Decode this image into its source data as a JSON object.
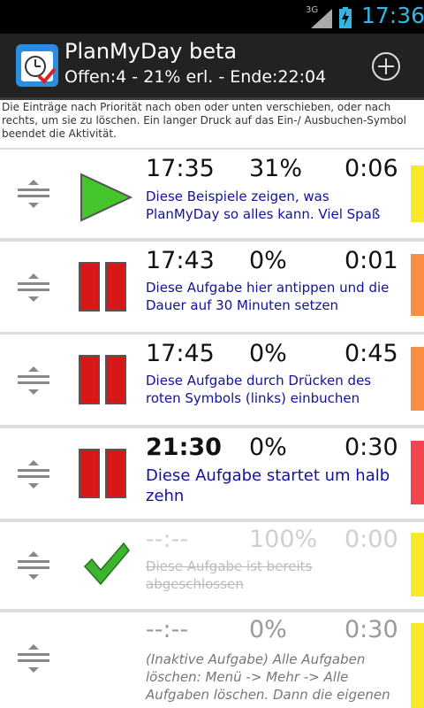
{
  "statusbar": {
    "network": "3G",
    "time": "17:36"
  },
  "header": {
    "title": "PlanMyDay beta",
    "subtitle": "Offen:4 - 21% erl. - Ende:22:04"
  },
  "help_text": "Die Einträge nach Priorität nach oben oder unten verschieben, oder nach rechts, um sie zu löschen. Ein langer Druck auf das Ein-/ Ausbuchen-Symbol beendet die Aktivität.",
  "colors": {
    "yellow": "#f7e92a",
    "orange": "#f78e41",
    "red": "#f0474f"
  },
  "tasks": [
    {
      "time": "17:35",
      "percent": "31%",
      "duration": "0:06",
      "description": "Diese Beispiele zeigen, was PlanMyDay so alles kann. Viel Spaß",
      "status": "play-icon",
      "priority_color": "yellow"
    },
    {
      "time": "17:43",
      "percent": "0%",
      "duration": "0:01",
      "description": "Diese Aufgabe hier antippen und die Dauer auf 30 Minuten setzen",
      "status": "pause-icon",
      "priority_color": "orange"
    },
    {
      "time": "17:45",
      "percent": "0%",
      "duration": "0:45",
      "description": "Diese Aufgabe durch Drücken des roten Symbols (links) einbuchen",
      "status": "pause-icon",
      "priority_color": "orange"
    },
    {
      "time": "21:30",
      "percent": "0%",
      "duration": "0:30",
      "description": "Diese Aufgabe startet um halb zehn",
      "status": "pause-icon",
      "priority_color": "red"
    },
    {
      "time": "--:--",
      "percent": "100%",
      "duration": "0:00",
      "description": "Diese Aufgabe ist bereits abgeschlossen",
      "status": "checkmark-icon",
      "priority_color": "yellow"
    },
    {
      "time": "--:--",
      "percent": "0%",
      "duration": "0:30",
      "description": "(Inaktive Aufgabe) Alle Aufgaben löschen: Menü -> Mehr -> Alle Aufgaben löschen. Dann die eigenen",
      "status": "none",
      "priority_color": "yellow"
    }
  ]
}
